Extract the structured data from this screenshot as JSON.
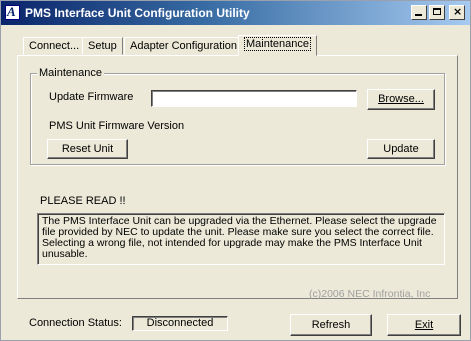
{
  "window": {
    "title": "PMS Interface Unit Configuration Utility",
    "app_icon_glyph": "A",
    "controls": {
      "minimize": "minimize-icon",
      "maximize": "maximize-icon",
      "close": "close-icon"
    }
  },
  "tabs": [
    {
      "label": "Connect...",
      "active": false
    },
    {
      "label": "Setup",
      "active": false
    },
    {
      "label": "Adapter Configuration",
      "active": false
    },
    {
      "label": "Maintenance",
      "active": true
    }
  ],
  "maintenance": {
    "group_label": "Maintenance",
    "update_firmware_label": "Update Firmware",
    "firmware_path_value": "",
    "browse_label": "Browse...",
    "firmware_version_label": "PMS Unit Firmware Version",
    "reset_label": "Reset Unit",
    "update_label": "Update"
  },
  "notice": {
    "heading": "PLEASE READ !!",
    "text": "The PMS Interface Unit can be upgraded via the Ethernet.  Please select the upgrade file provided by NEC to update the unit.  Please make sure you select the correct file.  Selecting a wrong file, not intended for upgrade may make the PMS Interface Unit unusable."
  },
  "copyright": "(c)2006 NEC Infrontia, Inc",
  "status": {
    "label": "Connection Status:",
    "value": "Disconnected"
  },
  "buttons": {
    "refresh": "Refresh",
    "exit": "Exit"
  },
  "colors": {
    "titlebar_start": "#0a246a",
    "titlebar_end": "#a6caf0",
    "face": "#ece9d8"
  }
}
